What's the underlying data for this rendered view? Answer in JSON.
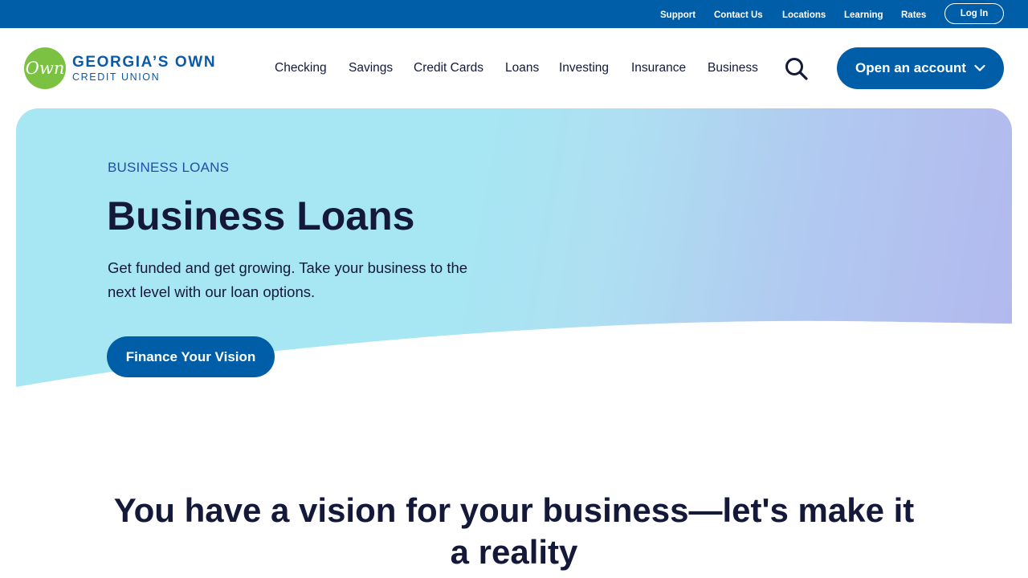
{
  "utility_nav": {
    "links": [
      "Support",
      "Contact Us",
      "Locations",
      "Learning",
      "Rates"
    ],
    "login_label": "Log In"
  },
  "logo": {
    "mark_text": "Own",
    "line1": "GEORGIA’S OWN",
    "line2": "CREDIT UNION"
  },
  "main_nav": {
    "items": [
      "Checking",
      "Savings",
      "Credit Cards",
      "Loans",
      "Investing",
      "Insurance",
      "Business"
    ],
    "open_account_label": "Open an account"
  },
  "hero": {
    "eyebrow": "BUSINESS LOANS",
    "title": "Business Loans",
    "description": "Get funded and get growing. Take your business to the next level with our loan options.",
    "cta_label": "Finance Your Vision"
  },
  "section": {
    "heading": "You have a vision for your business—let's make it a reality"
  },
  "icons": {
    "search": "search-icon",
    "chevron": "chevron-down-icon"
  },
  "colors": {
    "brand_blue": "#005ea8",
    "logo_green": "#7cc242",
    "text_dark": "#14193a",
    "hero_cyan": "#a7e6f3",
    "hero_lavender": "#b2b8ee"
  }
}
